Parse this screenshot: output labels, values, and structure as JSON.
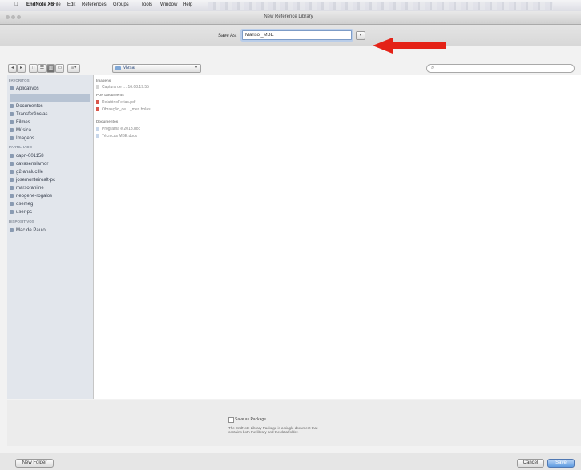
{
  "menubar": {
    "apple": "",
    "app": "EndNote X6",
    "items": [
      "File",
      "Edit",
      "References",
      "Groups",
      "Tools",
      "Window",
      "Help"
    ]
  },
  "window": {
    "title": "New Reference Library"
  },
  "save_as": {
    "label": "Save As:",
    "value": "Marisol_MBE",
    "expand": "▾"
  },
  "toolbar": {
    "back": "◂",
    "forward": "▸",
    "view_icon": "∷",
    "view_list": "☰",
    "view_columns": "▥",
    "view_coverflow": "▭",
    "arrange": "≡▾",
    "location": "Mesa",
    "search_icon": "⌕"
  },
  "sidebar": {
    "favorites_header": "FAVORITOS",
    "favorites": [
      "Aplicativos",
      "",
      "Documentos",
      "Transferências",
      "Filmes",
      "Música",
      "Imagens"
    ],
    "shared_header": "PARTILHADO",
    "shared": [
      "capn-001158",
      "cavasenslamor",
      "g2-analucílle",
      "josemonteiroalt-pc",
      "marsoraniine",
      "neogene-rogalos",
      "osemeg",
      "user-pc"
    ],
    "devices_header": "DISPOSITIVOS",
    "devices": [
      "Mac de Paulo"
    ]
  },
  "column1": {
    "sections": [
      {
        "header": "Imagens",
        "items": [
          {
            "name": "Captura de … 16.08.19.55",
            "type": "img"
          }
        ]
      },
      {
        "header": "PDF Documents",
        "items": [
          {
            "name": "RelatórioFerias.pdf",
            "type": "pdf"
          },
          {
            "name": "Obrasção_de…_mes.bolas",
            "type": "pdf"
          }
        ]
      },
      {
        "header": "Documentos",
        "items": [
          {
            "name": "Programa é 2013.doc",
            "type": "doc"
          },
          {
            "name": "Técnicas MBE.docx",
            "type": "doc"
          }
        ]
      }
    ]
  },
  "package": {
    "checkbox_label": "Save as Package",
    "checked": false,
    "description_line1": "The EndNote Library Package is a single document that",
    "description_line2": "contains both the library and the data folder."
  },
  "buttons": {
    "new_folder": "New Folder",
    "cancel": "Cancel",
    "save": "Save"
  },
  "colors": {
    "arrow": "#e42217",
    "save_button": "#5e9be1",
    "sidebar": "#e2e6ec"
  }
}
